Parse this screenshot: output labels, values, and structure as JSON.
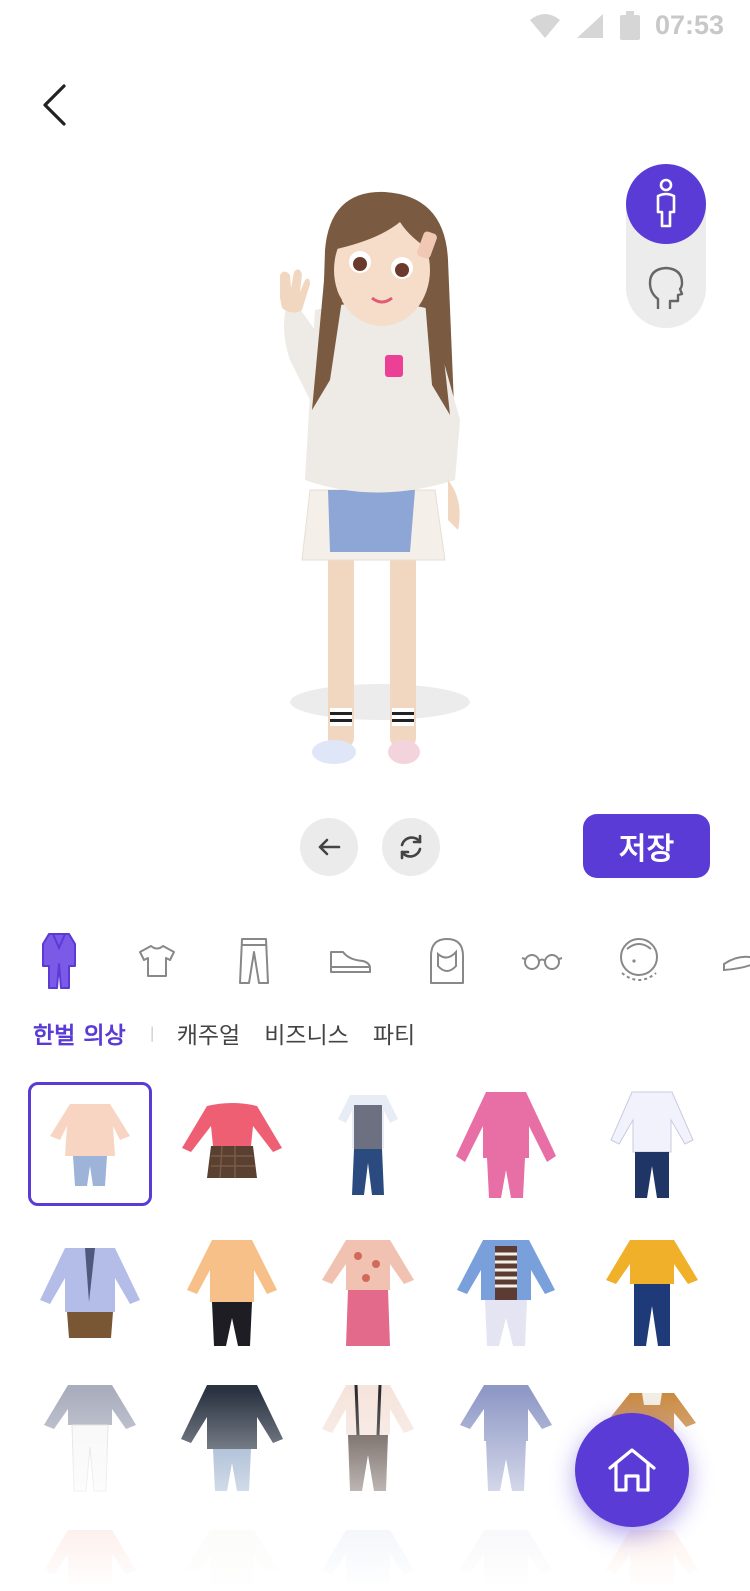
{
  "status_bar": {
    "time": "07:53",
    "icons": [
      "wifi-icon",
      "cell-signal-icon",
      "battery-icon"
    ]
  },
  "header": {
    "back_icon": "chevron-left-icon"
  },
  "view_toggle": {
    "options": [
      "full-body-icon",
      "head-icon"
    ],
    "active": "full-body-icon"
  },
  "controls": {
    "undo_icon": "arrow-left-icon",
    "reset_icon": "refresh-icon",
    "save_label": "저장"
  },
  "categories": [
    "outfit-icon",
    "top-icon",
    "pants-icon",
    "shoes-icon",
    "hair-icon",
    "glasses-icon",
    "face-icon",
    "hat-icon"
  ],
  "sub_tabs": {
    "items": [
      "한벌 의상",
      "캐주얼",
      "비즈니스",
      "파티"
    ],
    "active": "한벌 의상"
  },
  "outfits_selected_index": 0,
  "home_button": {
    "icon": "home-icon"
  },
  "colors": {
    "accent": "#5a3bd6",
    "button_bg": "#ebebeb",
    "toggle_bg": "#ececec"
  }
}
